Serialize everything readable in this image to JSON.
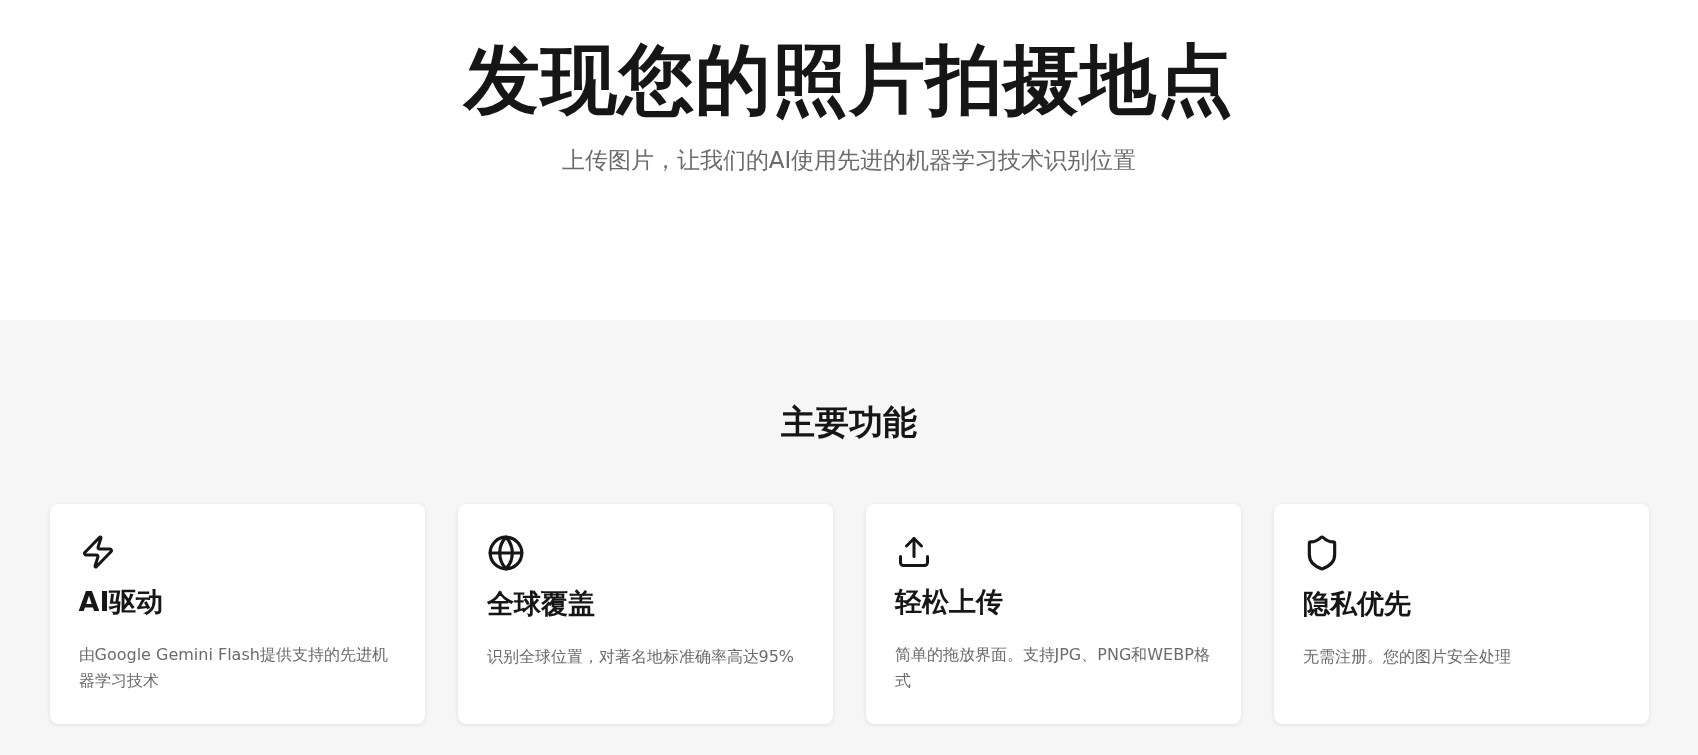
{
  "hero": {
    "title": "发现您的照片拍摄地点",
    "subtitle": "上传图片，让我们的AI使用先进的机器学习技术识别位置"
  },
  "features": {
    "heading": "主要功能",
    "cards": [
      {
        "kind": "zap",
        "title": "AI驱动",
        "description": "由Google Gemini Flash提供支持的先进机器学习技术"
      },
      {
        "kind": "globe",
        "title": "全球覆盖",
        "description": "识别全球位置，对著名地标准确率高达95%"
      },
      {
        "kind": "upload",
        "title": "轻松上传",
        "description": "简单的拖放界面。支持JPG、PNG和WEBP格式"
      },
      {
        "kind": "shield",
        "title": "隐私优先",
        "description": "无需注册。您的图片安全处理"
      }
    ]
  }
}
